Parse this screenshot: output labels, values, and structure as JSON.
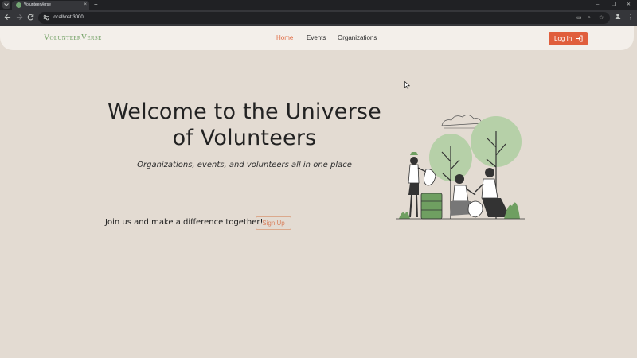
{
  "browser": {
    "tab_title": "VolunteerVerse",
    "tab_close": "×",
    "new_tab": "+",
    "url": "localhost:3000",
    "window_controls": {
      "minimize": "–",
      "restore": "❐",
      "close": "✕"
    }
  },
  "navbar": {
    "brand": "VolunteerVerse",
    "links": [
      {
        "label": "Home",
        "active": true
      },
      {
        "label": "Events",
        "active": false
      },
      {
        "label": "Organizations",
        "active": false
      }
    ],
    "login_label": "Log In"
  },
  "hero": {
    "title": "Welcome to the Universe of Volunteers",
    "subtitle": "Organizations, events, and volunteers all in one place",
    "cta_text": "Join us and make a difference together!",
    "signup_label": "Sign Up"
  },
  "colors": {
    "background": "#e3dbd2",
    "navbar_bg": "#f3efea",
    "brand": "#6f9f61",
    "accent": "#e05e3c",
    "illustration_green": "#b6d0a8",
    "illustration_dark_green": "#6f9f61"
  },
  "icons": {
    "login": "login-arrow-icon",
    "back": "back-arrow-icon",
    "forward": "forward-arrow-icon",
    "reload": "reload-icon"
  }
}
